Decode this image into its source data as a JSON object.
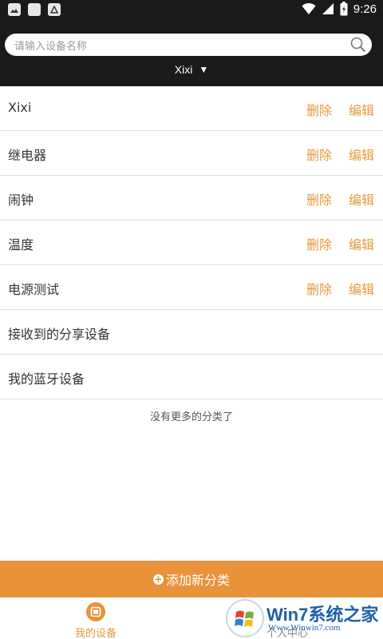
{
  "status_bar": {
    "time": "9:26",
    "left_icons": [
      "image-icon",
      "square-icon",
      "android-store-icon"
    ],
    "right_icons": [
      "wifi-icon",
      "signal-icon",
      "battery-icon"
    ]
  },
  "header": {
    "search_placeholder": "请输入设备名称",
    "selector_label": "Xixi",
    "selector_caret": "▼"
  },
  "categories": [
    {
      "label": "Xixi",
      "delete": "删除",
      "edit": "编辑"
    },
    {
      "label": "继电器",
      "delete": "删除",
      "edit": "编辑"
    },
    {
      "label": "闹钟",
      "delete": "删除",
      "edit": "编辑"
    },
    {
      "label": "温度",
      "delete": "删除",
      "edit": "编辑"
    },
    {
      "label": "电源测试",
      "delete": "删除",
      "edit": "编辑"
    },
    {
      "label": "接收到的分享设备"
    },
    {
      "label": "我的蓝牙设备"
    }
  ],
  "no_more_text": "没有更多的分类了",
  "add_button": {
    "plus": "+",
    "label": "添加新分类"
  },
  "tabs": {
    "devices_label": "我的设备",
    "profile_label": "个人中心"
  },
  "watermark": {
    "title": "Win7系统之家",
    "url": "Www.Winwin7.com"
  },
  "colors": {
    "accent": "#e8923a",
    "header_bg": "#1a1a1a",
    "action_text": "#e49a3e"
  }
}
